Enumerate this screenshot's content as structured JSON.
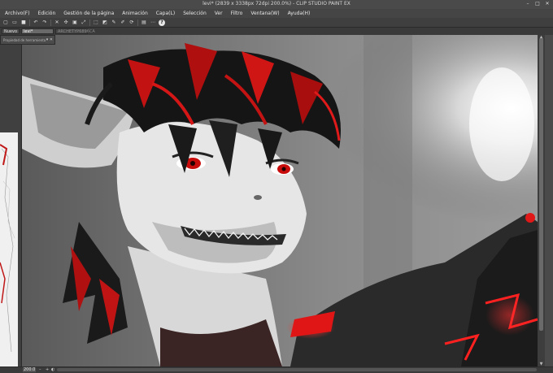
{
  "window": {
    "title": "levi* (2839 x 3338px 72dpi 200.0%) - CLIP STUDIO PAINT EX",
    "controls": [
      "–",
      "□",
      "✕"
    ]
  },
  "menu": [
    "Archivo(F)",
    "Edición",
    "Gestión de la página",
    "Animación",
    "Capa(L)",
    "Selección",
    "Ver",
    "Filtro",
    "Ventana(W)",
    "Ayuda(H)"
  ],
  "toolbar": {
    "help_label": "?"
  },
  "tabs": [
    {
      "label": "Nuevo"
    },
    {
      "label": "levi*"
    },
    {
      "label": "ARCHETYP6896CA"
    }
  ],
  "tool_property": {
    "label": "Propiedad de herramienta"
  },
  "status": {
    "zoom": "200.0"
  },
  "colors": {
    "accent_red": "#d11a1a",
    "ui_dark": "#3b3b3b"
  }
}
